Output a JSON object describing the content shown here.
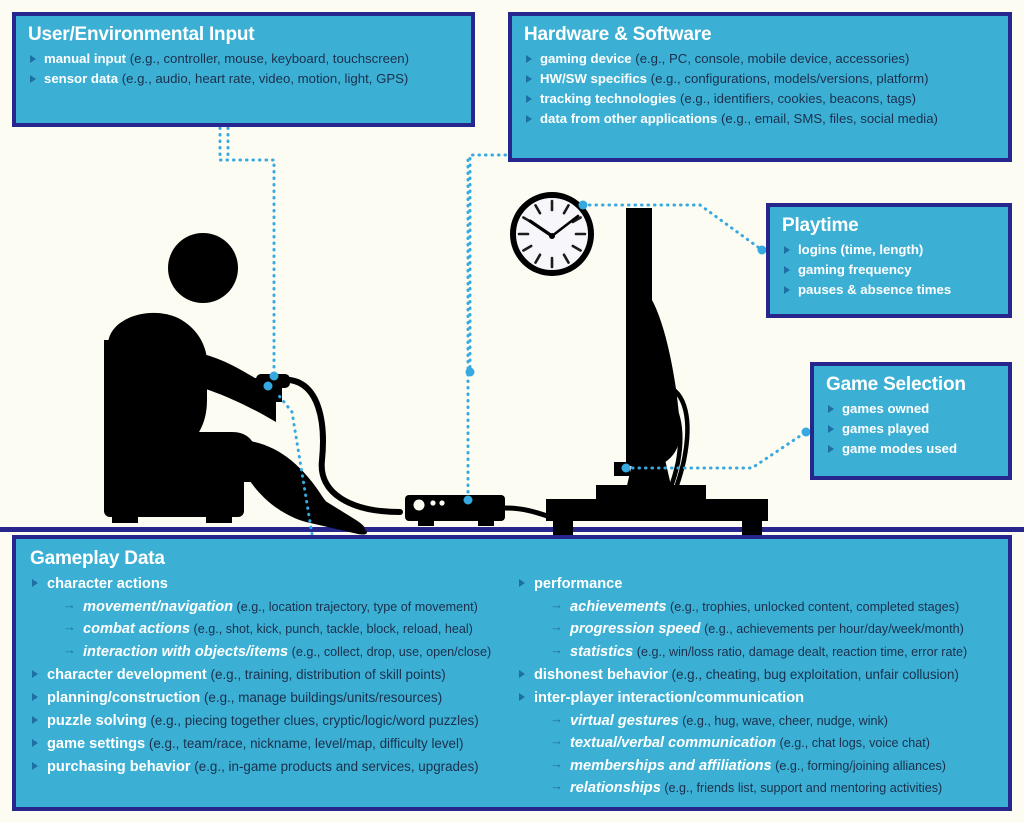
{
  "figure": {
    "background_color": "#fcfcf2",
    "box_fill_color": "#3cb0d4",
    "box_border_color": "#26268c",
    "connector_color": "#36a9e1",
    "illustration_color": "#000000"
  },
  "boxes": {
    "user_input": {
      "title": "User/Environmental Input",
      "items": [
        {
          "label": "manual input",
          "example": "(e.g., controller, mouse, keyboard, touchscreen)"
        },
        {
          "label": "sensor data",
          "example": "(e.g., audio, heart rate, video, motion, light, GPS)"
        }
      ]
    },
    "hardware_software": {
      "title": "Hardware & Software",
      "items": [
        {
          "label": "gaming device",
          "example": "(e.g., PC, console, mobile device, accessories)"
        },
        {
          "label": "HW/SW specifics",
          "example": "(e.g., configurations, models/versions, platform)"
        },
        {
          "label": "tracking technologies",
          "example": "(e.g., identifiers, cookies, beacons, tags)"
        },
        {
          "label": "data from other applications",
          "example": "(e.g., email, SMS, files, social media)"
        }
      ]
    },
    "playtime": {
      "title": "Playtime",
      "items": [
        {
          "label": "logins (time, length)",
          "example": ""
        },
        {
          "label": "gaming frequency",
          "example": ""
        },
        {
          "label": "pauses & absence times",
          "example": ""
        }
      ]
    },
    "game_selection": {
      "title": "Game Selection",
      "items": [
        {
          "label": "games owned",
          "example": ""
        },
        {
          "label": "games played",
          "example": ""
        },
        {
          "label": "game modes used",
          "example": ""
        }
      ]
    },
    "gameplay": {
      "title": "Gameplay Data",
      "left_column": [
        {
          "label": "character actions",
          "example": "",
          "subitems": [
            {
              "label": "movement/navigation",
              "example": "(e.g., location trajectory, type of movement)"
            },
            {
              "label": "combat actions",
              "example": "(e.g., shot, kick, punch, tackle, block, reload, heal)"
            },
            {
              "label": "interaction with objects/items",
              "example": "(e.g., collect, drop, use, open/close)"
            }
          ]
        },
        {
          "label": "character development",
          "example": "(e.g., training, distribution of skill points)",
          "subitems": []
        },
        {
          "label": "planning/construction",
          "example": "(e.g., manage buildings/units/resources)",
          "subitems": []
        },
        {
          "label": "puzzle solving",
          "example": "(e.g., piecing together clues, cryptic/logic/word puzzles)",
          "subitems": []
        },
        {
          "label": "game settings",
          "example": "(e.g., team/race, nickname, level/map, difficulty level)",
          "subitems": []
        },
        {
          "label": "purchasing behavior",
          "example": "(e.g., in-game products and services, upgrades)",
          "subitems": []
        }
      ],
      "right_column": [
        {
          "label": "performance",
          "example": "",
          "subitems": [
            {
              "label": "achievements",
              "example": "(e.g., trophies, unlocked content, completed stages)"
            },
            {
              "label": "progression speed",
              "example": "(e.g., achievements per hour/day/week/month)"
            },
            {
              "label": "statistics",
              "example": "(e.g., win/loss ratio, damage dealt, reaction time, error rate)"
            }
          ]
        },
        {
          "label": "dishonest behavior",
          "example": "(e.g., cheating, bug exploitation, unfair collusion)",
          "subitems": []
        },
        {
          "label": "inter-player interaction/communication",
          "example": "",
          "subitems": [
            {
              "label": "virtual gestures",
              "example": "(e.g., hug, wave, cheer, nudge, wink)"
            },
            {
              "label": "textual/verbal communication",
              "example": "(e.g., chat logs, voice chat)"
            },
            {
              "label": "memberships and affiliations",
              "example": "(e.g., forming/joining alliances)"
            },
            {
              "label": "relationships",
              "example": "(e.g., friends list, support and mentoring activities)"
            }
          ]
        }
      ]
    }
  },
  "illustration": {
    "elements": [
      "seated-player-silhouette",
      "game-controller",
      "controller-cable",
      "wall-clock",
      "television-side-view",
      "tv-stand-table",
      "stacked-media-shelf",
      "game-console"
    ]
  }
}
